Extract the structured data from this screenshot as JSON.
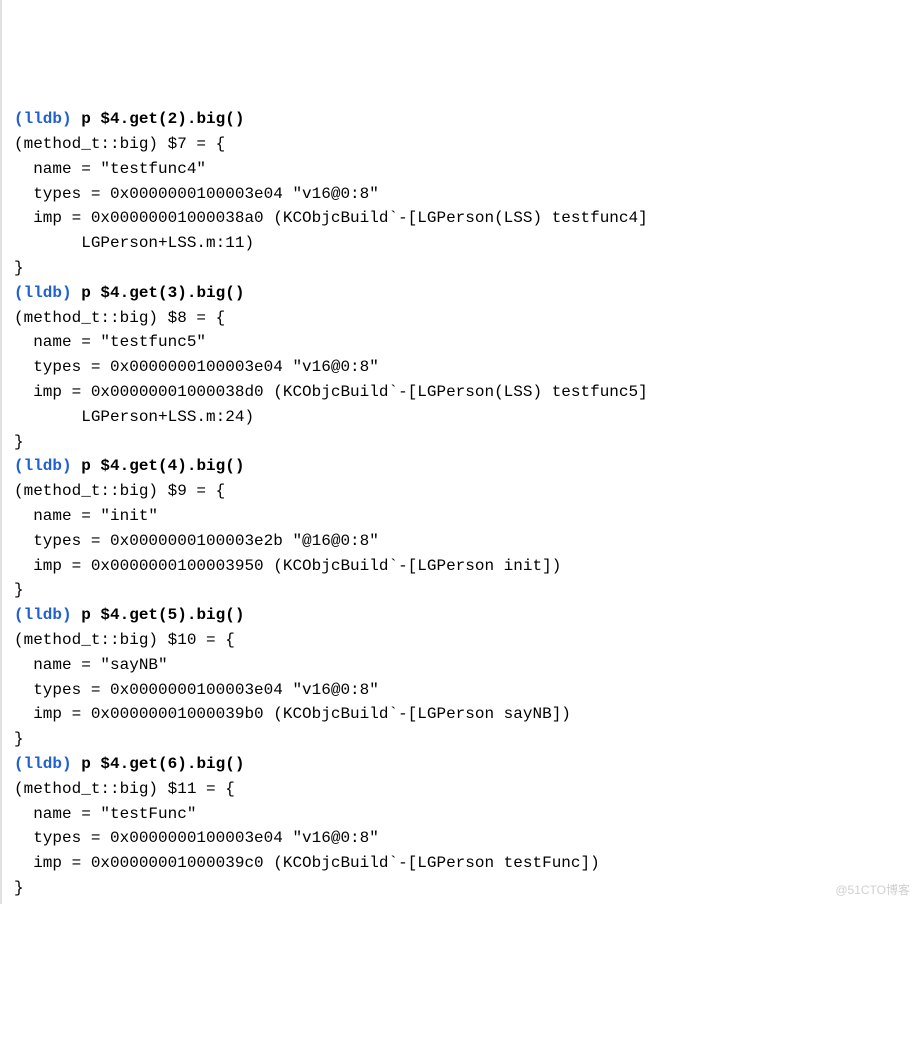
{
  "prompt_label": "(lldb)",
  "entries": [
    {
      "cmd": "p $4.get(2).big()",
      "result_type": "(method_t::big)",
      "result_var": "$7",
      "name": "testfunc4",
      "types_addr": "0x0000000100003e04",
      "types_sig": "\"v16@0:8\"",
      "imp_addr": "0x00000001000038a0",
      "imp_desc": "(KCObjcBuild`-[LGPerson(LSS) testfunc4]",
      "imp_cont": "LGPerson+LSS.m:11)"
    },
    {
      "cmd": "p $4.get(3).big()",
      "result_type": "(method_t::big)",
      "result_var": "$8",
      "name": "testfunc5",
      "types_addr": "0x0000000100003e04",
      "types_sig": "\"v16@0:8\"",
      "imp_addr": "0x00000001000038d0",
      "imp_desc": "(KCObjcBuild`-[LGPerson(LSS) testfunc5]",
      "imp_cont": "LGPerson+LSS.m:24)"
    },
    {
      "cmd": "p $4.get(4).big()",
      "result_type": "(method_t::big)",
      "result_var": "$9",
      "name": "init",
      "types_addr": "0x0000000100003e2b",
      "types_sig": "\"@16@0:8\"",
      "imp_addr": "0x0000000100003950",
      "imp_desc": "(KCObjcBuild`-[LGPerson init])",
      "imp_cont": ""
    },
    {
      "cmd": "p $4.get(5).big()",
      "result_type": "(method_t::big)",
      "result_var": "$10",
      "name": "sayNB",
      "types_addr": "0x0000000100003e04",
      "types_sig": "\"v16@0:8\"",
      "imp_addr": "0x00000001000039b0",
      "imp_desc": "(KCObjcBuild`-[LGPerson sayNB])",
      "imp_cont": ""
    },
    {
      "cmd": "p $4.get(6).big()",
      "result_type": "(method_t::big)",
      "result_var": "$11",
      "name": "testFunc",
      "types_addr": "0x0000000100003e04",
      "types_sig": "\"v16@0:8\"",
      "imp_addr": "0x00000001000039c0",
      "imp_desc": "(KCObjcBuild`-[LGPerson testFunc])",
      "imp_cont": ""
    }
  ],
  "watermark": "@51CTO博客"
}
